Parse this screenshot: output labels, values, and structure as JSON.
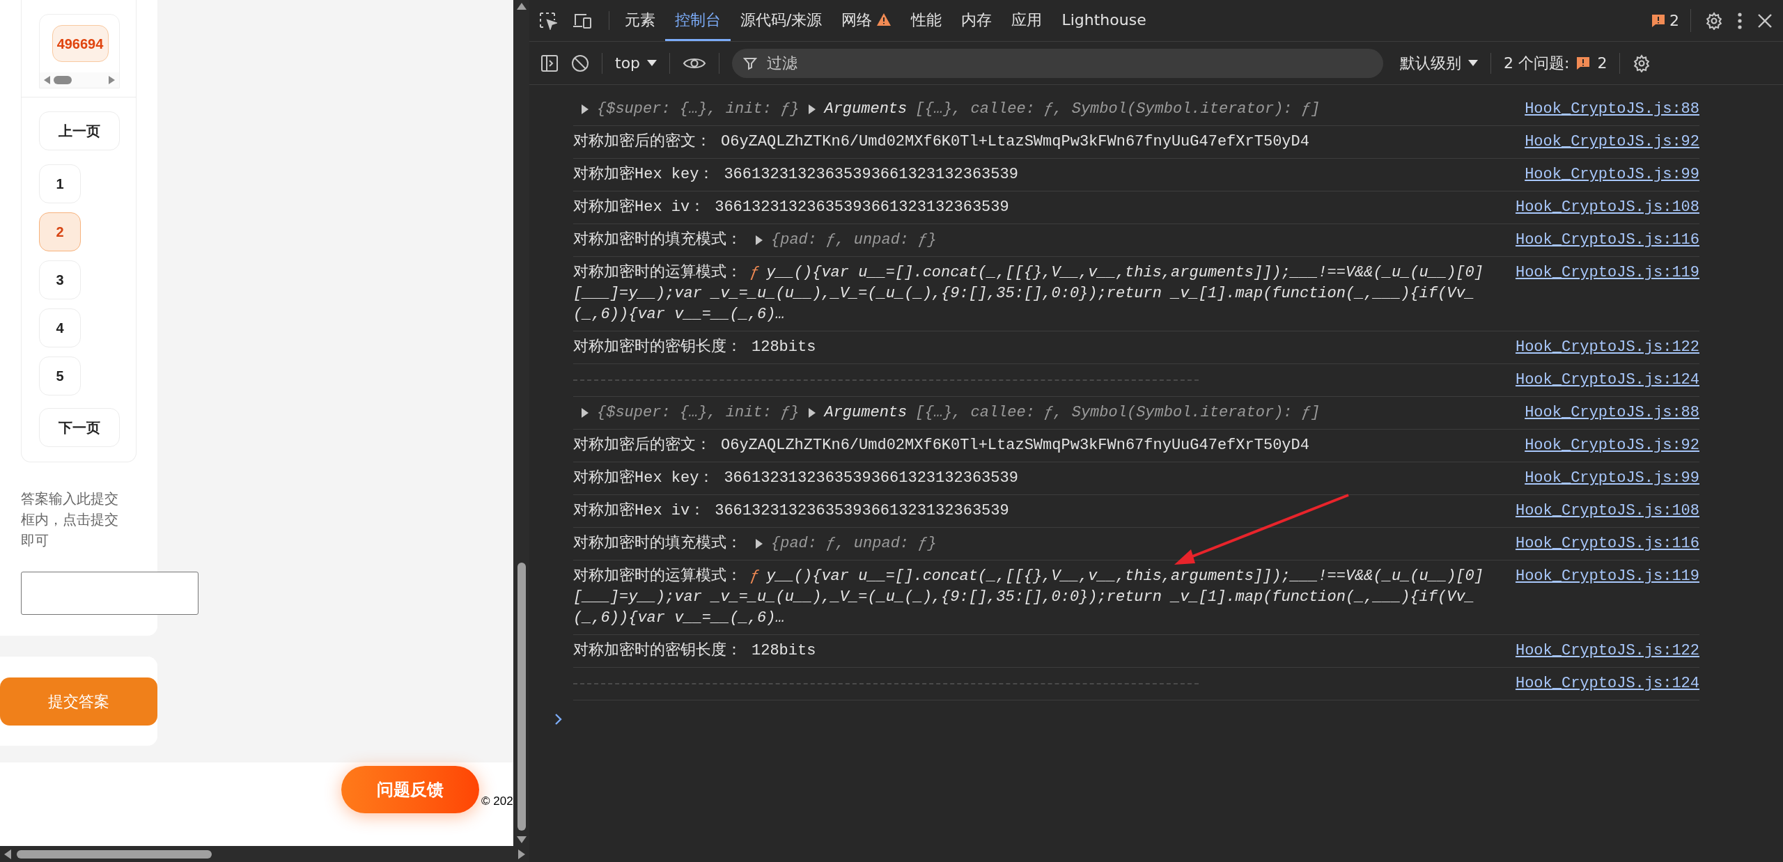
{
  "page": {
    "captcha_code": "496694",
    "pagination": {
      "prev": "上一页",
      "next": "下一页",
      "pages": [
        {
          "label": "1",
          "selected": false
        },
        {
          "label": "2",
          "selected": true
        },
        {
          "label": "3",
          "selected": false
        },
        {
          "label": "4",
          "selected": false
        },
        {
          "label": "5",
          "selected": false
        }
      ]
    },
    "answer_hint": "答案输入此提交框内，点击提交即可",
    "submit_button": "提交答案",
    "feedback_button": "问题反馈",
    "footer_text": "© 202"
  },
  "devtools": {
    "tabs": [
      {
        "label": "元素",
        "selected": false,
        "warning": false
      },
      {
        "label": "控制台",
        "selected": true,
        "warning": false
      },
      {
        "label": "源代码/来源",
        "selected": false,
        "warning": false
      },
      {
        "label": "网络",
        "selected": false,
        "warning": true
      },
      {
        "label": "性能",
        "selected": false,
        "warning": false
      },
      {
        "label": "内存",
        "selected": false,
        "warning": false
      },
      {
        "label": "应用",
        "selected": false,
        "warning": false
      },
      {
        "label": "Lighthouse",
        "selected": false,
        "warning": false
      }
    ],
    "issues_badge": "2",
    "toolbar": {
      "context": "top",
      "filter_placeholder": "过滤",
      "level": "默认级别",
      "issues_label": "2 个问题:",
      "issues_count": "2"
    },
    "console": [
      {
        "kind": "objects",
        "parts": [
          {
            "preview": "{$super: {…}, init: ƒ}"
          },
          {
            "name": "Arguments",
            "preview": "[{…}, callee: ƒ, Symbol(Symbol.iterator): ƒ]"
          }
        ],
        "source": "Hook_CryptoJS.js:88"
      },
      {
        "kind": "text",
        "label": "对称加密后的密文：",
        "value": "O6yZAQLZhZTKn6/Umd02MXf6K0Tl+LtazSWmqPw3kFWn67fnyUuG47efXrT50yD4",
        "source": "Hook_CryptoJS.js:92"
      },
      {
        "kind": "text",
        "label": "对称加密Hex key：",
        "value": "36613231323635393661323132363539",
        "source": "Hook_CryptoJS.js:99"
      },
      {
        "kind": "text",
        "label": "对称加密Hex iv：",
        "value": "36613231323635393661323132363539",
        "source": "Hook_CryptoJS.js:108"
      },
      {
        "kind": "object",
        "label": "对称加密时的填充模式：",
        "preview": "{pad: ƒ, unpad: ƒ}",
        "source": "Hook_CryptoJS.js:116"
      },
      {
        "kind": "function",
        "label": "对称加密时的运算模式：",
        "mark": "ƒ",
        "code": "y__(){var u__=[].concat(_,[[{},V__,v__,this,arguments]]);___!==V&&(_u_(u__)[0][___]=y__);var _v_=_u_(u__),_V_=(_u_(_),{9:[],35:[],0:0});return _v_[1].map(function(_,___){if(Vv_(_,6)){var v__=__(_,6)…",
        "source": "Hook_CryptoJS.js:119"
      },
      {
        "kind": "text",
        "label": "对称加密时的密钥长度：",
        "value": "128bits",
        "source": "Hook_CryptoJS.js:122"
      },
      {
        "kind": "separator",
        "source": "Hook_CryptoJS.js:124"
      },
      {
        "kind": "objects",
        "parts": [
          {
            "preview": "{$super: {…}, init: ƒ}"
          },
          {
            "name": "Arguments",
            "preview": "[{…}, callee: ƒ, Symbol(Symbol.iterator): ƒ]"
          }
        ],
        "source": "Hook_CryptoJS.js:88"
      },
      {
        "kind": "text",
        "label": "对称加密后的密文：",
        "value": "O6yZAQLZhZTKn6/Umd02MXf6K0Tl+LtazSWmqPw3kFWn67fnyUuG47efXrT50yD4",
        "source": "Hook_CryptoJS.js:92"
      },
      {
        "kind": "text",
        "label": "对称加密Hex key：",
        "value": "36613231323635393661323132363539",
        "source": "Hook_CryptoJS.js:99"
      },
      {
        "kind": "text",
        "label": "对称加密Hex iv：",
        "value": "36613231323635393661323132363539",
        "source": "Hook_CryptoJS.js:108"
      },
      {
        "kind": "object",
        "label": "对称加密时的填充模式：",
        "preview": "{pad: ƒ, unpad: ƒ}",
        "source": "Hook_CryptoJS.js:116"
      },
      {
        "kind": "function",
        "label": "对称加密时的运算模式：",
        "mark": "ƒ",
        "code": "y__(){var u__=[].concat(_,[[{},V__,v__,this,arguments]]);___!==V&&(_u_(u__)[0][___]=y__);var _v_=_u_(u__),_V_=(_u_(_),{9:[],35:[],0:0});return _v_[1].map(function(_,___){if(Vv_(_,6)){var v__=__(_,6)…",
        "source": "Hook_CryptoJS.js:119"
      },
      {
        "kind": "text",
        "label": "对称加密时的密钥长度：",
        "value": "128bits",
        "source": "Hook_CryptoJS.js:122"
      },
      {
        "kind": "separator",
        "source": "Hook_CryptoJS.js:124"
      }
    ]
  }
}
